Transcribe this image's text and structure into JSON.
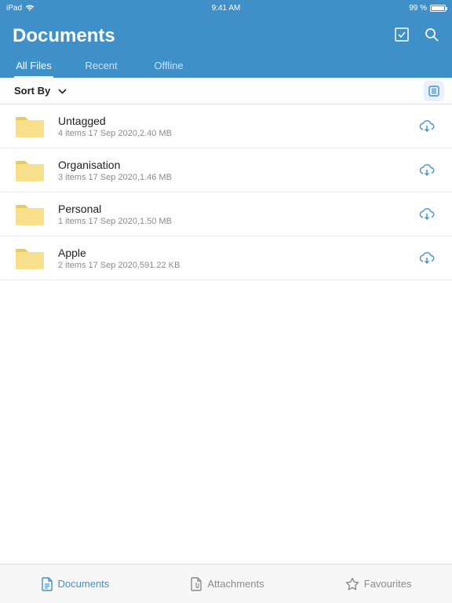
{
  "status": {
    "device": "iPad",
    "time": "9:41 AM",
    "battery": "99 %"
  },
  "header": {
    "title": "Documents",
    "tabs": [
      {
        "label": "All Files",
        "active": true
      },
      {
        "label": "Recent",
        "active": false
      },
      {
        "label": "Offline",
        "active": false
      }
    ]
  },
  "sortbar": {
    "label": "Sort By"
  },
  "folders": [
    {
      "name": "Untagged",
      "meta": "4 items  17 Sep 2020,2.40 MB"
    },
    {
      "name": "Organisation",
      "meta": "3 items  17 Sep 2020,1.46 MB"
    },
    {
      "name": "Personal",
      "meta": "1 items  17 Sep 2020,1.50 MB"
    },
    {
      "name": "Apple",
      "meta": "2 items  17 Sep 2020,591.22 KB"
    }
  ],
  "bottom": {
    "items": [
      {
        "label": "Documents",
        "active": true
      },
      {
        "label": "Attachments",
        "active": false
      },
      {
        "label": "Favourites",
        "active": false
      }
    ]
  },
  "colors": {
    "accent": "#3f8fc9",
    "folder": "#f7df8c",
    "folderDark": "#e9c95f"
  }
}
